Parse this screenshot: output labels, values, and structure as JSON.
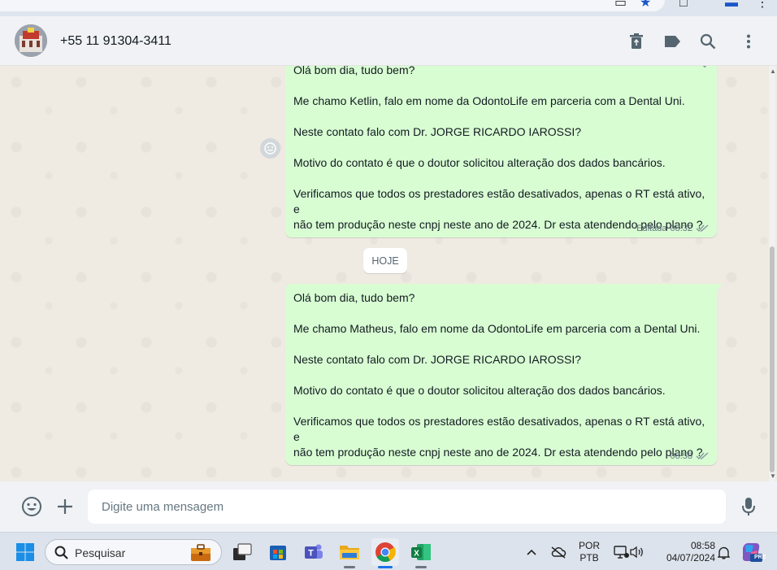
{
  "header": {
    "contact_name": "+55 11 91304-3411"
  },
  "chat": {
    "messages": [
      {
        "lines": [
          "Olá bom dia, tudo bem?",
          "",
          "Me chamo Ketlin, falo em nome da OdontoLife em parceria com a Dental Uni.",
          "",
          "Neste contato falo com Dr. JORGE RICARDO IAROSSI?",
          "",
          "Motivo do contato é que o doutor solicitou alteração dos dados bancários.",
          "",
          "Verificamos que todos os prestadores estão desativados, apenas o RT está ativo, e",
          "não tem produção neste cnpj neste ano de 2024. Dr esta atendendo pelo plano ?"
        ],
        "edited_label": "Editada",
        "time": "08:32"
      },
      {
        "lines": [
          "Olá bom dia, tudo bem?",
          "",
          "Me chamo Matheus, falo em nome da OdontoLife em parceria com a Dental Uni.",
          "",
          "Neste contato falo com Dr. JORGE RICARDO IAROSSI?",
          "",
          "Motivo do contato é que o doutor solicitou alteração dos dados bancários.",
          "",
          "Verificamos que todos os prestadores estão desativados, apenas o RT está ativo, e",
          "não tem produção neste cnpj neste ano de 2024. Dr esta atendendo pelo plano ?"
        ],
        "time": "08:58"
      }
    ],
    "date_divider": "HOJE"
  },
  "composer": {
    "placeholder": "Digite uma mensagem"
  },
  "taskbar": {
    "search_label": "Pesquisar",
    "language_top": "POR",
    "language_bottom": "PTB",
    "time": "08:58",
    "date": "04/07/2024",
    "copilot_badge": "PRE"
  },
  "colors": {
    "bubble_out": "#d9fdd3",
    "chat_bg": "#efeae2",
    "header_bg": "#f0f2f5",
    "icon_gray": "#54656f",
    "read_ticks": "#8696a0"
  }
}
